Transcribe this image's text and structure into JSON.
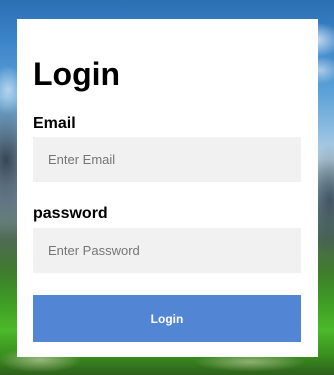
{
  "login_form": {
    "title": "Login",
    "email_label": "Email",
    "email_placeholder": "Enter Email",
    "email_value": "",
    "password_label": "password",
    "password_placeholder": "Enter Password",
    "password_value": "",
    "submit_label": "Login"
  },
  "colors": {
    "card_background": "#ffffff",
    "input_background": "#f1f1f1",
    "button_background": "#5286d4",
    "button_text": "#ffffff"
  }
}
